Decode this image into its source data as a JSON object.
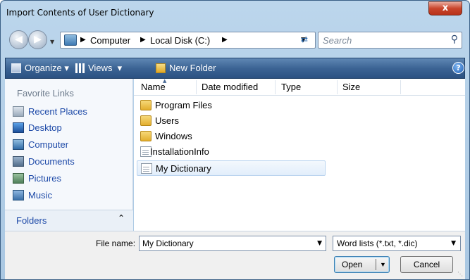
{
  "window": {
    "title": "Import Contents of User Dictionary",
    "close_label": "x"
  },
  "address": {
    "crumbs": [
      "Computer",
      "Local Disk (C:)"
    ],
    "search_placeholder": "Search"
  },
  "toolbar": {
    "organize": "Organize",
    "views": "Views",
    "new_folder": "New Folder"
  },
  "sidebar": {
    "heading": "Favorite Links",
    "items": [
      {
        "label": "Recent Places",
        "icon": "recent-places-icon"
      },
      {
        "label": "Desktop",
        "icon": "desktop-icon"
      },
      {
        "label": "Computer",
        "icon": "computer-icon"
      },
      {
        "label": "Documents",
        "icon": "documents-icon"
      },
      {
        "label": "Pictures",
        "icon": "pictures-icon"
      },
      {
        "label": "Music",
        "icon": "music-icon"
      }
    ],
    "folders_label": "Folders"
  },
  "filelist": {
    "columns": [
      "Name",
      "Date modified",
      "Type",
      "Size"
    ],
    "rows": [
      {
        "name": "Program Files",
        "kind": "folder"
      },
      {
        "name": "Users",
        "kind": "folder"
      },
      {
        "name": "Windows",
        "kind": "folder"
      },
      {
        "name": "InstallationInfo",
        "kind": "file"
      },
      {
        "name": "My Dictionary",
        "kind": "file",
        "selected": true
      }
    ]
  },
  "bottom": {
    "file_name_label": "File name:",
    "file_name_value": "My Dictionary",
    "file_type_value": "Word lists (*.txt, *.dic)",
    "open_label": "Open",
    "cancel_label": "Cancel"
  },
  "colors": {
    "accent": "#3c6494",
    "link": "#1e4aa8",
    "selection": "#e2eefb"
  }
}
